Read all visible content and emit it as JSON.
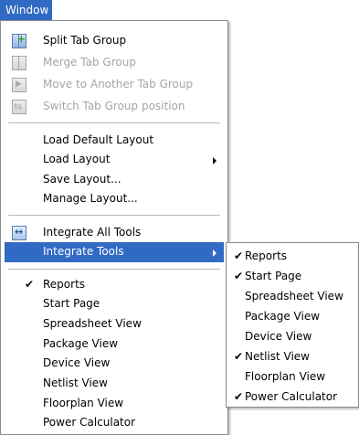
{
  "menubar": {
    "title": "Window"
  },
  "menu": {
    "groups": [
      [
        {
          "label": "Split Tab Group",
          "icon": "split-tab-group-icon",
          "enabled": true
        },
        {
          "label": "Merge Tab Group",
          "icon": "merge-tab-group-icon",
          "enabled": false
        },
        {
          "label": "Move to Another Tab Group",
          "icon": "move-tab-icon",
          "enabled": false
        },
        {
          "label": "Switch Tab Group position",
          "icon": "switch-tab-group-icon",
          "enabled": false
        }
      ],
      [
        {
          "label": "Load Default Layout"
        },
        {
          "label": "Load Layout",
          "has_submenu": true
        },
        {
          "label": "Save Layout..."
        },
        {
          "label": "Manage Layout..."
        }
      ],
      [
        {
          "label": "Integrate All Tools",
          "icon": "integrate-all-tools-icon"
        },
        {
          "label": "Integrate Tools",
          "has_submenu": true,
          "highlighted": true
        }
      ],
      [
        {
          "label": "Reports",
          "checked": true
        },
        {
          "label": "Start Page",
          "checked": false
        },
        {
          "label": "Spreadsheet View",
          "checked": false
        },
        {
          "label": "Package View",
          "checked": false
        },
        {
          "label": "Device View",
          "checked": false
        },
        {
          "label": "Netlist View",
          "checked": false
        },
        {
          "label": "Floorplan View",
          "checked": false
        },
        {
          "label": "Power Calculator",
          "checked": false
        }
      ]
    ]
  },
  "submenu": {
    "items": [
      {
        "label": "Reports",
        "checked": true
      },
      {
        "label": "Start Page",
        "checked": true
      },
      {
        "label": "Spreadsheet View",
        "checked": false
      },
      {
        "label": "Package View",
        "checked": false
      },
      {
        "label": "Device View",
        "checked": false
      },
      {
        "label": "Netlist View",
        "checked": true
      },
      {
        "label": "Floorplan View",
        "checked": false
      },
      {
        "label": "Power Calculator",
        "checked": true
      }
    ]
  },
  "glyphs": {
    "check": "✔"
  },
  "colors": {
    "highlight": "#316ac5",
    "disabled_text": "#a5a5a5"
  }
}
